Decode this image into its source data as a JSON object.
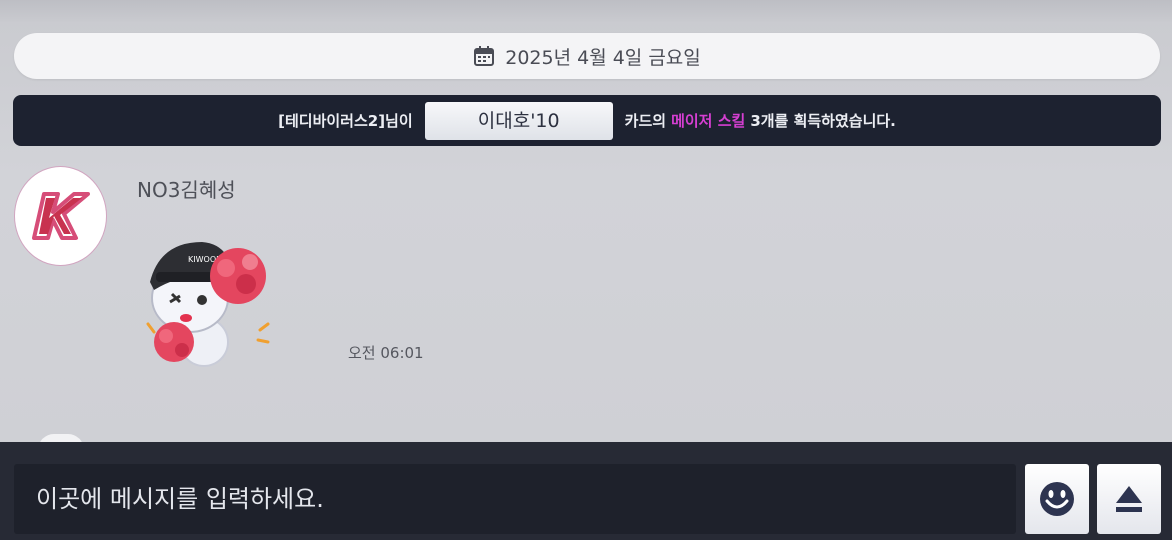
{
  "date_banner": {
    "icon": "calendar-icon",
    "text": "2025년 4월 4일 금요일"
  },
  "notice": {
    "prefix": "[테디바이러스2]님이",
    "player": "이대호'10",
    "middle": "카드의",
    "highlight": "메이저 스킬",
    "suffix": "3개를 획득하였습니다.",
    "highlight_color": "#d63fd2"
  },
  "message": {
    "avatar_icon": "team-k-logo",
    "sender": "NO3김혜성",
    "sticker_icon": "cheerleader-sticker",
    "time": "오전 06:01"
  },
  "composer": {
    "placeholder": "이곳에 메시지를 입력하세요.",
    "emoji_icon": "smiley-icon",
    "send_icon": "eject-send-icon"
  }
}
